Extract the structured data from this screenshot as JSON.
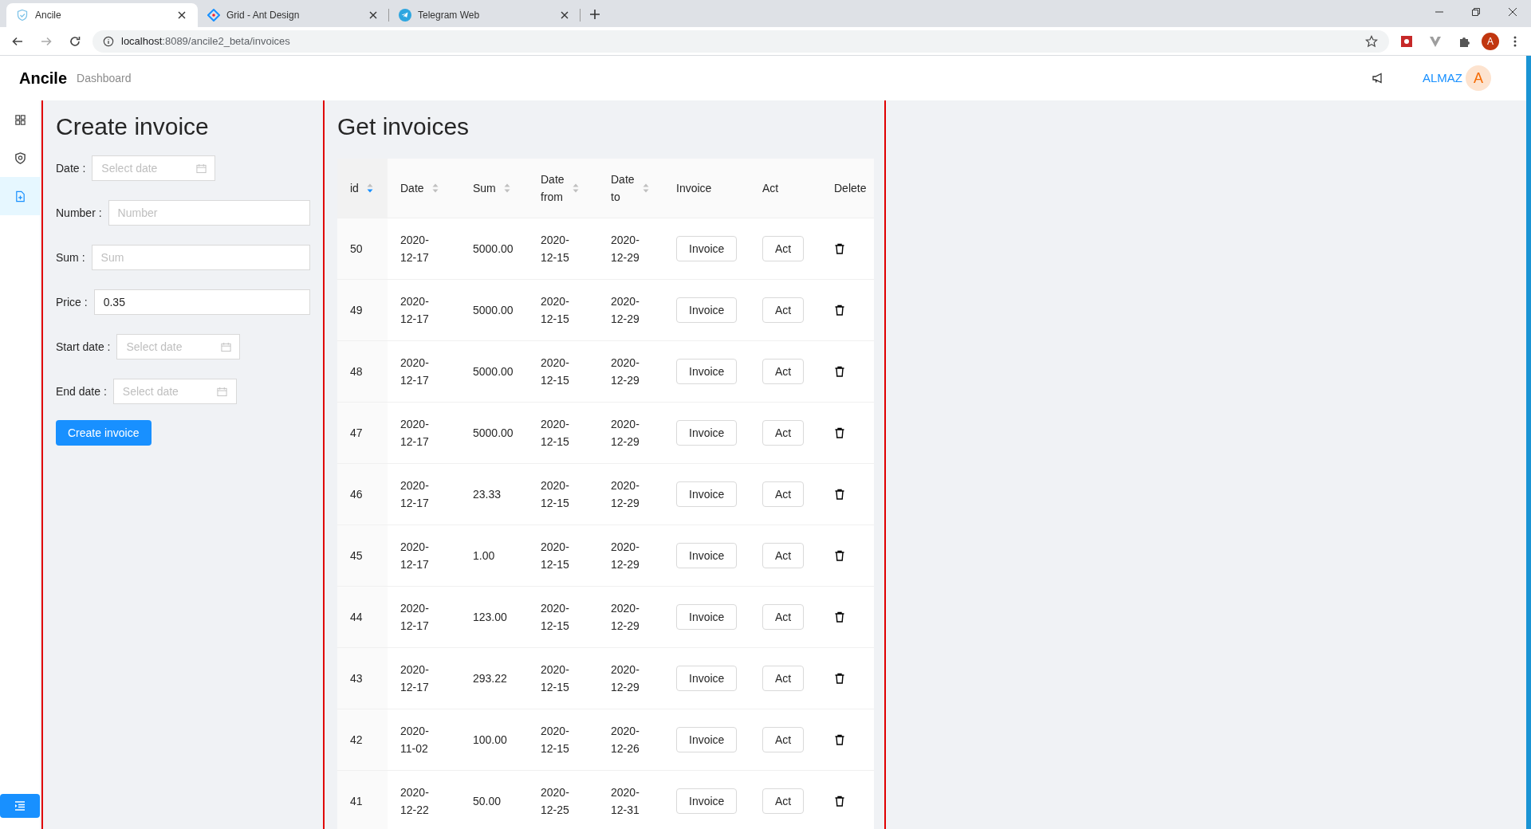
{
  "browser": {
    "tabs": [
      {
        "title": "Ancile",
        "selected": true
      },
      {
        "title": "Grid - Ant Design",
        "selected": false
      },
      {
        "title": "Telegram Web",
        "selected": false
      }
    ],
    "url_host": "localhost",
    "url_rest": ":8089/ancile2_beta/invoices",
    "profile_initial": "A"
  },
  "header": {
    "logo": "Ancile",
    "breadcrumb": "Dashboard",
    "user": "ALMAZ",
    "avatar": "A"
  },
  "sidebar": {
    "items": [
      {
        "selected": false
      },
      {
        "selected": false
      },
      {
        "selected": true
      }
    ]
  },
  "create_form": {
    "title": "Create invoice",
    "fields": [
      {
        "label": "Date :",
        "kind": "date",
        "placeholder": "Select date"
      },
      {
        "label": "Number :",
        "kind": "text",
        "placeholder": "Number"
      },
      {
        "label": "Sum :",
        "kind": "text",
        "placeholder": "Sum"
      },
      {
        "label": "Price :",
        "kind": "text",
        "value": "0.35"
      },
      {
        "label": "Start date :",
        "kind": "date",
        "placeholder": "Select date"
      },
      {
        "label": "End date :",
        "kind": "date",
        "placeholder": "Select date"
      }
    ],
    "submit": "Create invoice"
  },
  "invoices": {
    "title": "Get invoices",
    "columns": [
      {
        "lines": [
          "id"
        ],
        "sortable": true,
        "sorted": true
      },
      {
        "lines": [
          "Date"
        ],
        "sortable": true,
        "sorted": false
      },
      {
        "lines": [
          "Sum"
        ],
        "sortable": true,
        "sorted": false
      },
      {
        "lines": [
          "Date",
          "from"
        ],
        "sortable": true,
        "sorted": false
      },
      {
        "lines": [
          "Date",
          "to"
        ],
        "sortable": true,
        "sorted": false
      },
      {
        "lines": [
          "Invoice"
        ]
      },
      {
        "lines": [
          "Act"
        ]
      },
      {
        "lines": [
          "Delete"
        ]
      }
    ],
    "rows": [
      {
        "id": "50",
        "date": [
          "2020-",
          "12-17"
        ],
        "sum": "5000.00",
        "from": [
          "2020-",
          "12-15"
        ],
        "to": [
          "2020-",
          "12-29"
        ],
        "invoice": "Invoice",
        "act": "Act"
      },
      {
        "id": "49",
        "date": [
          "2020-",
          "12-17"
        ],
        "sum": "5000.00",
        "from": [
          "2020-",
          "12-15"
        ],
        "to": [
          "2020-",
          "12-29"
        ],
        "invoice": "Invoice",
        "act": "Act"
      },
      {
        "id": "48",
        "date": [
          "2020-",
          "12-17"
        ],
        "sum": "5000.00",
        "from": [
          "2020-",
          "12-15"
        ],
        "to": [
          "2020-",
          "12-29"
        ],
        "invoice": "Invoice",
        "act": "Act"
      },
      {
        "id": "47",
        "date": [
          "2020-",
          "12-17"
        ],
        "sum": "5000.00",
        "from": [
          "2020-",
          "12-15"
        ],
        "to": [
          "2020-",
          "12-29"
        ],
        "invoice": "Invoice",
        "act": "Act"
      },
      {
        "id": "46",
        "date": [
          "2020-",
          "12-17"
        ],
        "sum": "23.33",
        "from": [
          "2020-",
          "12-15"
        ],
        "to": [
          "2020-",
          "12-29"
        ],
        "invoice": "Invoice",
        "act": "Act"
      },
      {
        "id": "45",
        "date": [
          "2020-",
          "12-17"
        ],
        "sum": "1.00",
        "from": [
          "2020-",
          "12-15"
        ],
        "to": [
          "2020-",
          "12-29"
        ],
        "invoice": "Invoice",
        "act": "Act"
      },
      {
        "id": "44",
        "date": [
          "2020-",
          "12-17"
        ],
        "sum": "123.00",
        "from": [
          "2020-",
          "12-15"
        ],
        "to": [
          "2020-",
          "12-29"
        ],
        "invoice": "Invoice",
        "act": "Act"
      },
      {
        "id": "43",
        "date": [
          "2020-",
          "12-17"
        ],
        "sum": "293.22",
        "from": [
          "2020-",
          "12-15"
        ],
        "to": [
          "2020-",
          "12-29"
        ],
        "invoice": "Invoice",
        "act": "Act"
      },
      {
        "id": "42",
        "date": [
          "2020-",
          "11-02"
        ],
        "sum": "100.00",
        "from": [
          "2020-",
          "12-15"
        ],
        "to": [
          "2020-",
          "12-26"
        ],
        "invoice": "Invoice",
        "act": "Act"
      },
      {
        "id": "41",
        "date": [
          "2020-",
          "12-22"
        ],
        "sum": "50.00",
        "from": [
          "2020-",
          "12-25"
        ],
        "to": [
          "2020-",
          "12-31"
        ],
        "invoice": "Invoice",
        "act": "Act"
      }
    ]
  }
}
